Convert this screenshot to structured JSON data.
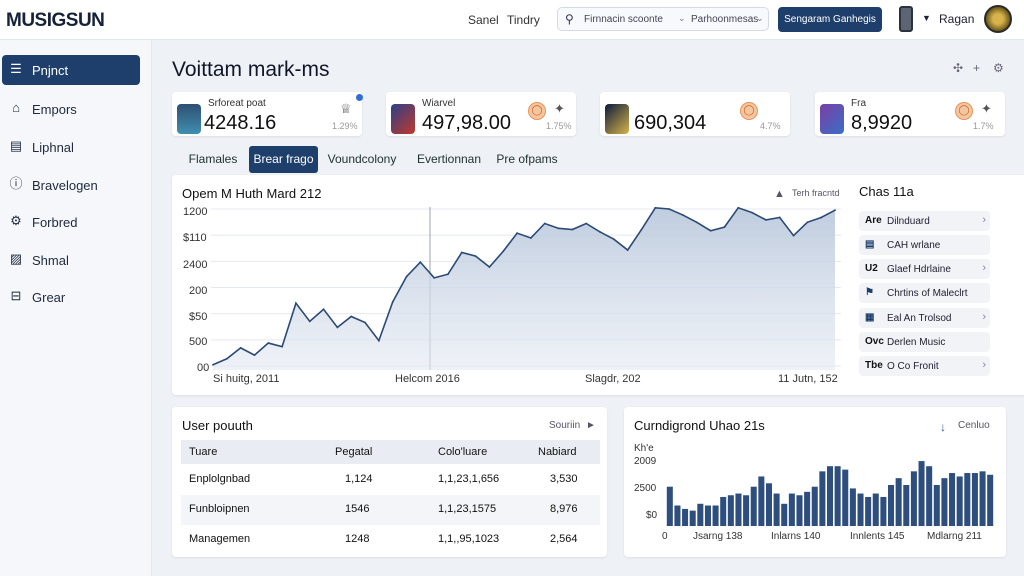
{
  "app": {
    "logo": "MUSIGSUN"
  },
  "topbar": {
    "links": [
      "Sanel",
      "Tindry"
    ],
    "search": {
      "left_text": "Firnnacin scoonte",
      "right_text": "Parhoonmesas"
    },
    "primary_button": "Sengaram Ganhegis",
    "user": "Ragan"
  },
  "sidebar": {
    "items": [
      {
        "label": "Pnjnct",
        "icon": "menu-icon",
        "active": true
      },
      {
        "label": "Empors",
        "icon": "home-icon",
        "active": false
      },
      {
        "label": "Liphnal",
        "icon": "card-icon",
        "active": false
      },
      {
        "label": "Bravelogen",
        "icon": "info-icon",
        "active": false
      },
      {
        "label": "Forbred",
        "icon": "gear-icon",
        "active": false
      },
      {
        "label": "Shmal",
        "icon": "chart-icon",
        "active": false
      },
      {
        "label": "Grear",
        "icon": "box-icon",
        "active": false
      }
    ]
  },
  "page": {
    "title": "Voittam mark-ms"
  },
  "kpis": [
    {
      "label": "Srforeat poat",
      "value": "4248.16",
      "delta": "1.29%"
    },
    {
      "label": "Wiarvel",
      "value": "497,98.00",
      "delta": "1.75%"
    },
    {
      "label": "",
      "value": "690,304",
      "delta": "4.7%"
    },
    {
      "label": "Fra",
      "value": "8,9920",
      "delta": "1.7%"
    }
  ],
  "tabs": [
    "Flamales",
    "Brear frago",
    "Voundcolony",
    "Evertionnan",
    "Pre ofpams"
  ],
  "main_chart": {
    "title": "Opem M Huth Mard 212",
    "tool_label": "Terh fracntd",
    "y_ticks": [
      "1200",
      "$110",
      "2400",
      "200",
      "$50",
      "500",
      "00"
    ],
    "x_ticks": [
      "Si huitg, 2011",
      "Helcom 2016",
      "Slagdr, 202",
      "11 Jutn, 152"
    ]
  },
  "right_panel": {
    "title": "Chas 11a",
    "items": [
      {
        "prefix": "Are",
        "label": "Dilnduard"
      },
      {
        "prefix": "",
        "label": "CAH wrlane"
      },
      {
        "prefix": "U2",
        "label": "Glaef Hdrlaine"
      },
      {
        "prefix": "",
        "label": "Chrtins of Maleclrt"
      },
      {
        "prefix": "",
        "label": "Eal An Trolsod"
      },
      {
        "prefix": "Ovc",
        "label": "Derlen Music"
      },
      {
        "prefix": "Tbe",
        "label": "O Co Fronit"
      }
    ]
  },
  "table": {
    "title": "User pouuth",
    "action": "Souriin",
    "headers": [
      "Tuare",
      "Pegatal",
      "Colo'luare",
      "Nabiard"
    ],
    "rows": [
      [
        "Enplolgnbad",
        "1,124",
        "1,1,23,1,656",
        "3,530"
      ],
      [
        "Funbloipnen",
        "1546",
        "1,1,23,1575",
        "8,976"
      ],
      [
        "Managemen",
        "1248",
        "1,1,,95,1023",
        "2,564"
      ]
    ]
  },
  "bar_chart": {
    "title": "Curndigrond Uhao 21s",
    "action": "Cenluo",
    "y_ticks": [
      "Kh'e\n2009",
      "2500",
      "$0",
      "0"
    ],
    "x_ticks": [
      "Jsarng 138",
      "Inlarns 140",
      "Innlents 145",
      "Mdlarng 211"
    ]
  },
  "chart_data": [
    {
      "type": "area",
      "title": "Opem M Huth Mard 212",
      "x_ticks": [
        "Si huitg, 2011",
        "Helcom 2016",
        "Slagdr, 202",
        "11 Jutn, 152"
      ],
      "values": [
        10,
        60,
        150,
        90,
        190,
        160,
        520,
        370,
        470,
        320,
        410,
        360,
        210,
        530,
        740,
        860,
        730,
        760,
        940,
        910,
        820,
        950,
        1100,
        1060,
        1180,
        1140,
        1130,
        1180,
        1110,
        1050,
        960,
        1130,
        1310,
        1300,
        1250,
        1190,
        1120,
        1150,
        1310,
        1270,
        1210,
        1230,
        1080,
        1190,
        1230,
        1290
      ],
      "ylim": [
        0,
        1300
      ],
      "grid": true,
      "color": "#2c4a75"
    },
    {
      "type": "bar",
      "title": "Curndigrond Uhao 21s",
      "x_ticks": [
        "Jsarng 138",
        "Inlarns 140",
        "Innlents 145",
        "Mdlarng 211"
      ],
      "values": [
        2300,
        1200,
        1000,
        900,
        1300,
        1200,
        1200,
        1700,
        1800,
        1900,
        1800,
        2300,
        2900,
        2500,
        1900,
        1300,
        1900,
        1800,
        2000,
        2300,
        3200,
        3500,
        3500,
        3300,
        2200,
        1900,
        1700,
        1900,
        1700,
        2400,
        2800,
        2400,
        3200,
        3800,
        3500,
        2400,
        2800,
        3100,
        2900,
        3100,
        3100,
        3200,
        3000
      ],
      "ylim": [
        0,
        4800
      ],
      "color": "#2e4e7e"
    }
  ],
  "colors": {
    "accent": "#1e3f6c",
    "line": "#2c4a75",
    "fill": "#c7d3e3"
  }
}
